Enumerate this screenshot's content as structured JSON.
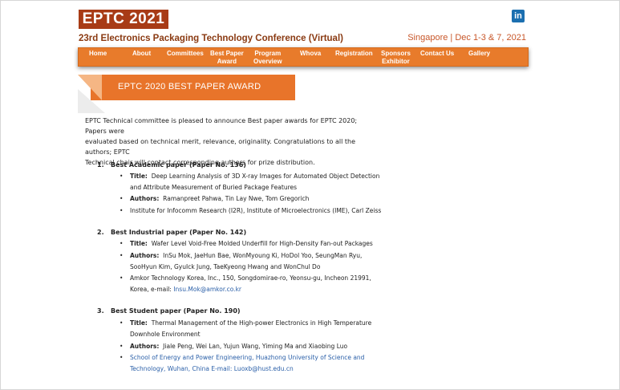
{
  "header": {
    "logo": "EPTC 2021",
    "conference_title": "23rd Electronics Packaging Technology Conference (Virtual)",
    "venue": "Singapore | Dec 1-3 & 7, 2021",
    "social": "in"
  },
  "nav": [
    {
      "label": "Home"
    },
    {
      "label": "About"
    },
    {
      "label": "Committees"
    },
    {
      "label1": "Best Paper",
      "label2": "Award"
    },
    {
      "label1": "Program",
      "label2": "Overview"
    },
    {
      "label": "Whova"
    },
    {
      "label": "Registration"
    },
    {
      "label1": "Sponsors",
      "label2": "Exhibitor"
    },
    {
      "label": "Contact Us"
    },
    {
      "label": "Gallery"
    }
  ],
  "banner": "EPTC 2020 BEST PAPER AWARD",
  "intro": [
    "EPTC Technical committee is pleased to announce Best paper awards for EPTC 2020; Papers were",
    "evaluated based on technical merit, relevance, originality. Congratulations to all the authors; EPTC",
    "Technical chair will contact corresponding authors for prize distribution."
  ],
  "papers": [
    {
      "number": "1.",
      "heading": "Best Academic paper (Paper No. 136)",
      "title_label": "Title:",
      "title_l1": "Deep Learning Analysis of 3D X-ray Images for Automated Object Detection",
      "title_l2": "and Attribute Measurement of Buried Package Features",
      "authors_label": "Authors:",
      "authors_l1": "Ramanpreet Pahwa, Tin Lay Nwe, Tom Gregorich",
      "affil_l1": "Institute for Infocomm Research (I2R), Institute of Microelectronics (IME),  Carl Zeiss"
    },
    {
      "number": "2.",
      "heading": "Best Industrial paper (Paper No. 142)",
      "title_label": "Title:",
      "title_l1": "Wafer Level Void-Free Molded Underfill for High-Density Fan-out Packages",
      "authors_label": "Authors:",
      "authors_l1": "InSu Mok, JaeHun Bae, WonMyoung Ki, HoDol Yoo, SeungMan Ryu,",
      "authors_l2": "SooHyun Kim, GyuIck Jung, TaeKyeong Hwang and WonChul Do",
      "affil_l1": "Amkor Technology Korea, Inc., 150, Songdomirae-ro, Yeonsu-gu, Incheon 21991,",
      "affil_l2a": "Korea, e-mail: ",
      "email": "Insu.Mok@amkor.co.kr"
    },
    {
      "number": "3.",
      "heading": "Best Student paper (Paper No. 190)",
      "title_label": "Title:",
      "title_l1": "Thermal Management of the High-power Electronics in High Temperature",
      "title_l2": "Downhole Environment",
      "authors_label": "Authors:",
      "authors_l1": "Jiale Peng, Wei Lan, Yujun Wang, Yiming Ma and Xiaobing Luo",
      "affil_l1": "School of Energy and Power Engineering, Huazhong University of Science and",
      "affil_l2a": "Technology, Wuhan, China E-mail: ",
      "email": "Luoxb@hust.edu.cn"
    }
  ]
}
